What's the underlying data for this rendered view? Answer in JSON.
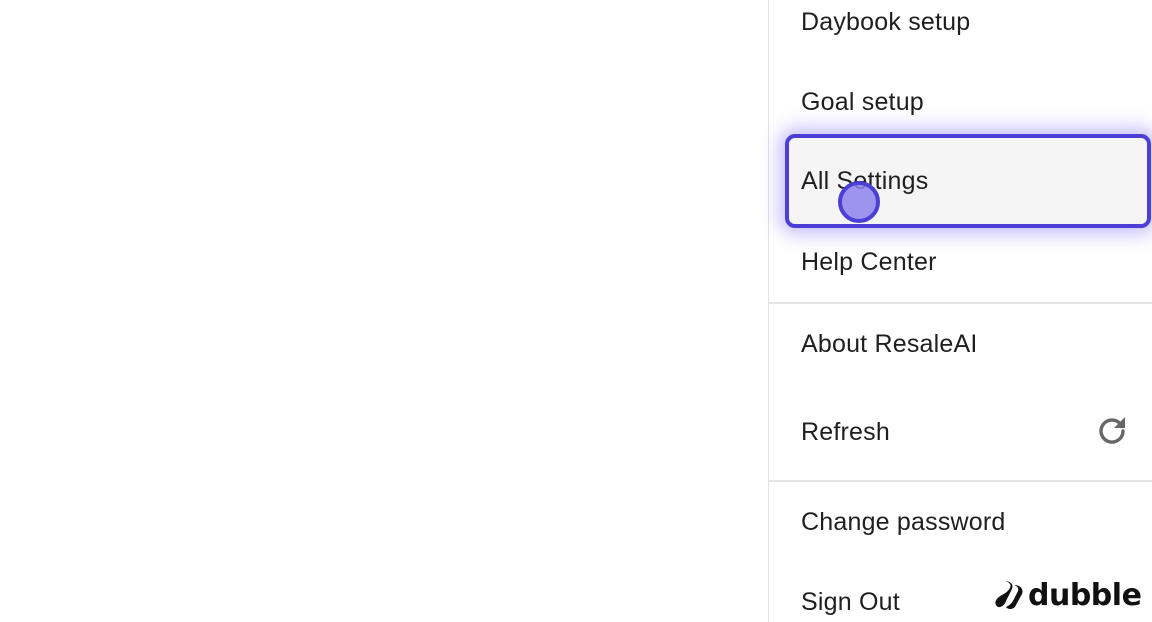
{
  "menu": {
    "items": [
      {
        "label": "Daybook setup"
      },
      {
        "label": "Goal setup"
      },
      {
        "label": "All Settings"
      },
      {
        "label": "Help Center"
      },
      {
        "label": "About ResaleAI"
      },
      {
        "label": "Refresh",
        "icon": "refresh-icon"
      },
      {
        "label": "Change password"
      },
      {
        "label": "Sign Out"
      }
    ]
  },
  "brand": {
    "name": "dubble",
    "icon": "dubble-logo-icon"
  },
  "colors": {
    "highlight": "#4b3fd6",
    "text": "#1f1f1f",
    "divider": "#e4e4e4"
  }
}
